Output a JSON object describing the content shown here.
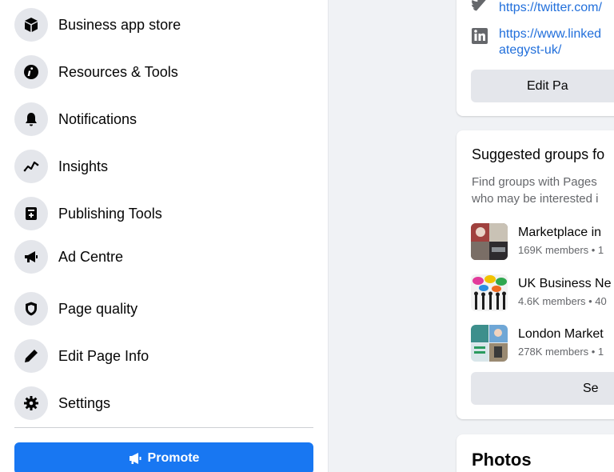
{
  "sidebar": {
    "items": [
      {
        "label": "Business app store",
        "icon": "box-icon"
      },
      {
        "label": "Resources & Tools",
        "icon": "info-icon"
      },
      {
        "label": "Notifications",
        "icon": "bell-icon"
      },
      {
        "label": "Insights",
        "icon": "chart-line-icon"
      },
      {
        "label": "Publishing Tools",
        "icon": "publishing-icon"
      },
      {
        "label": "Ad Centre",
        "icon": "megaphone-icon"
      },
      {
        "label": "Page quality",
        "icon": "shield-icon"
      },
      {
        "label": "Edit Page Info",
        "icon": "pencil-icon"
      },
      {
        "label": "Settings",
        "icon": "gear-icon"
      }
    ],
    "promote_label": "Promote"
  },
  "about": {
    "twitter_link": "https://twitter.com/",
    "linkedin_link_line1": "https://www.linked",
    "linkedin_link_line2": "ategyst-uk/",
    "edit_button": "Edit Pa"
  },
  "suggested": {
    "title": "Suggested groups fo",
    "desc_line1": "Find groups with Pages",
    "desc_line2": "who may be interested i",
    "groups": [
      {
        "name": "Marketplace in",
        "meta": "169K members • 1"
      },
      {
        "name": "UK Business Ne",
        "meta": "4.6K members • 40"
      },
      {
        "name": "London Market",
        "meta": "278K members • 1"
      }
    ],
    "see_all": "Se"
  },
  "photos": {
    "title": "Photos"
  },
  "colors": {
    "accent": "#1877f2",
    "link": "#216fdb",
    "icon_bg": "#e4e6eb",
    "page_bg": "#f0f2f5"
  }
}
